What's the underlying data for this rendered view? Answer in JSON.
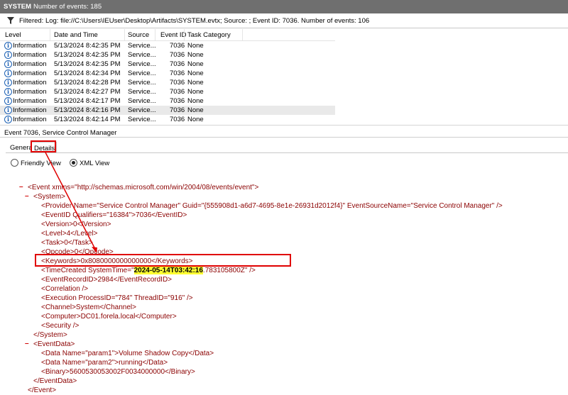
{
  "titlebar": {
    "log_name": "SYSTEM",
    "count_text": "Number of events: 185"
  },
  "filter": {
    "text": "Filtered: Log: file://C:\\Users\\IEUser\\Desktop\\Artifacts\\SYSTEM.evtx; Source: ; Event ID: 7036. Number of events: 106"
  },
  "grid": {
    "columns": [
      "Level",
      "Date and Time",
      "Source",
      "Event ID",
      "Task Category"
    ],
    "rows": [
      [
        "Information",
        "5/13/2024 8:42:35 PM",
        "Service...",
        "7036",
        "None"
      ],
      [
        "Information",
        "5/13/2024 8:42:35 PM",
        "Service...",
        "7036",
        "None"
      ],
      [
        "Information",
        "5/13/2024 8:42:35 PM",
        "Service...",
        "7036",
        "None"
      ],
      [
        "Information",
        "5/13/2024 8:42:34 PM",
        "Service...",
        "7036",
        "None"
      ],
      [
        "Information",
        "5/13/2024 8:42:28 PM",
        "Service...",
        "7036",
        "None"
      ],
      [
        "Information",
        "5/13/2024 8:42:27 PM",
        "Service...",
        "7036",
        "None"
      ],
      [
        "Information",
        "5/13/2024 8:42:17 PM",
        "Service...",
        "7036",
        "None"
      ],
      [
        "Information",
        "5/13/2024 8:42:16 PM",
        "Service...",
        "7036",
        "None"
      ],
      [
        "Information",
        "5/13/2024 8:42:14 PM",
        "Service...",
        "7036",
        "None"
      ]
    ],
    "selected_row": 7
  },
  "event": {
    "header": "Event 7036, Service Control Manager",
    "tabs": [
      "General",
      "Details"
    ],
    "active_tab": "Details",
    "view_options": [
      "Friendly View",
      "XML View"
    ],
    "selected_view": "XML View"
  },
  "xml": {
    "event_open": "<Event xmlns=\"http://schemas.microsoft.com/win/2004/08/events/event\">",
    "system_open": "<System>",
    "provider": "<Provider Name=\"Service Control Manager\" Guid=\"{555908d1-a6d7-4695-8e1e-26931d2012f4}\" EventSourceName=\"Service Control Manager\" />",
    "eventid": "<EventID Qualifiers=\"16384\">7036</EventID>",
    "version": "<Version>0</Version>",
    "level": "<Level>4</Level>",
    "task": "<Task>0</Task>",
    "opcode": "<Opcode>0</Opcode>",
    "keywords": "<Keywords>0x8080000000000000</Keywords>",
    "timecreated_pre": "<TimeCreated SystemTime=\"",
    "timecreated_hl": "2024-05-14T03:42:16",
    "timecreated_post": ".783105800Z\" />",
    "record": "<EventRecordID>2984</EventRecordID>",
    "correlation": "<Correlation />",
    "execution": "<Execution ProcessID=\"784\" ThreadID=\"916\" />",
    "channel": "<Channel>System</Channel>",
    "computer": "<Computer>DC01.forela.local</Computer>",
    "security": "<Security />",
    "system_close": "</System>",
    "eventdata_open": "<EventData>",
    "data1": "<Data Name=\"param1\">Volume Shadow Copy</Data>",
    "data2": "<Data Name=\"param2\">running</Data>",
    "binary": "<Binary>5600530053002F0034000000</Binary>",
    "eventdata_close": "</EventData>",
    "event_close": "</Event>",
    "collapse_glyph": "–"
  },
  "colors": {
    "annotation_red": "#e00000",
    "highlight": "#ffff33",
    "xml_tag": "#8b0000",
    "xml_bracket": "#0000ff"
  }
}
